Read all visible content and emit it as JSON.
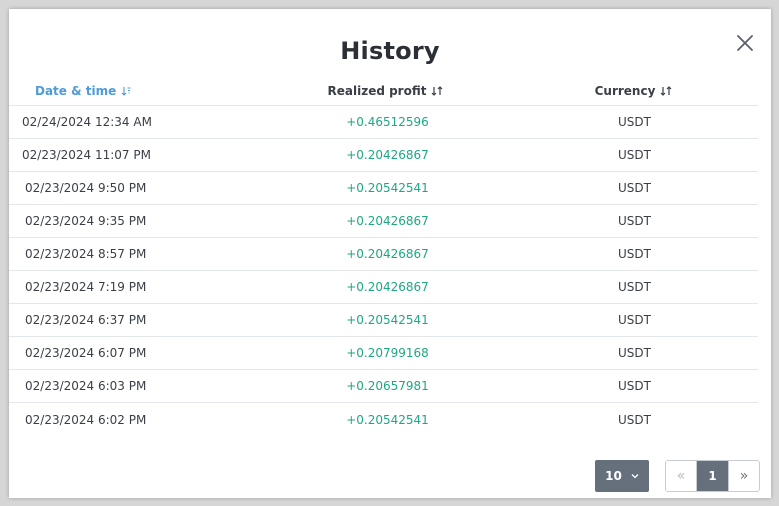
{
  "modal": {
    "title": "History"
  },
  "table": {
    "headers": [
      {
        "label": "Date & time",
        "sort_icon": "sort-desc-icon",
        "active": true
      },
      {
        "label": "Realized profit",
        "sort_icon": "sort-icon",
        "active": false
      },
      {
        "label": "Currency",
        "sort_icon": "sort-icon",
        "active": false
      }
    ],
    "rows": [
      {
        "date": "02/24/2024 12:34 AM",
        "profit": "+0.46512596",
        "currency": "USDT"
      },
      {
        "date": "02/23/2024 11:07 PM",
        "profit": "+0.20426867",
        "currency": "USDT"
      },
      {
        "date": "02/23/2024 9:50 PM",
        "profit": "+0.20542541",
        "currency": "USDT"
      },
      {
        "date": "02/23/2024 9:35 PM",
        "profit": "+0.20426867",
        "currency": "USDT"
      },
      {
        "date": "02/23/2024 8:57 PM",
        "profit": "+0.20426867",
        "currency": "USDT"
      },
      {
        "date": "02/23/2024 7:19 PM",
        "profit": "+0.20426867",
        "currency": "USDT"
      },
      {
        "date": "02/23/2024 6:37 PM",
        "profit": "+0.20542541",
        "currency": "USDT"
      },
      {
        "date": "02/23/2024 6:07 PM",
        "profit": "+0.20799168",
        "currency": "USDT"
      },
      {
        "date": "02/23/2024 6:03 PM",
        "profit": "+0.20657981",
        "currency": "USDT"
      },
      {
        "date": "02/23/2024 6:02 PM",
        "profit": "+0.20542541",
        "currency": "USDT"
      }
    ]
  },
  "pagination": {
    "page_size": "10",
    "prev": "«",
    "current_page": "1",
    "next": "»"
  },
  "colors": {
    "active_header": "#4e9bd8",
    "profit_positive": "#1ea784",
    "button_bg": "#65707c"
  }
}
